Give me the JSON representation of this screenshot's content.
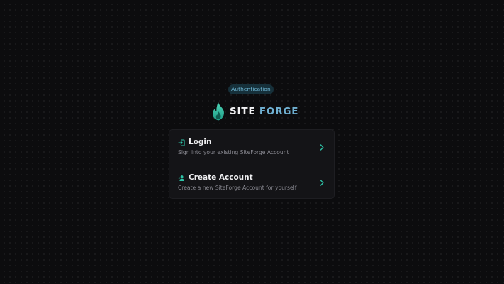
{
  "badge": {
    "label": "Authentication"
  },
  "logo": {
    "word1": "SITE",
    "word2": "FORGE"
  },
  "options": [
    {
      "title": "Login",
      "description": "Sign into your existing SiteForge Account",
      "icon": "login-icon"
    },
    {
      "title": "Create Account",
      "description": "Create a new SiteForge Account for yourself",
      "icon": "add-user-icon"
    }
  ],
  "colors": {
    "accent": "#2ec4a8",
    "brand_blue": "#6fb0d2",
    "background": "#0c0c0e",
    "card": "#141417"
  }
}
